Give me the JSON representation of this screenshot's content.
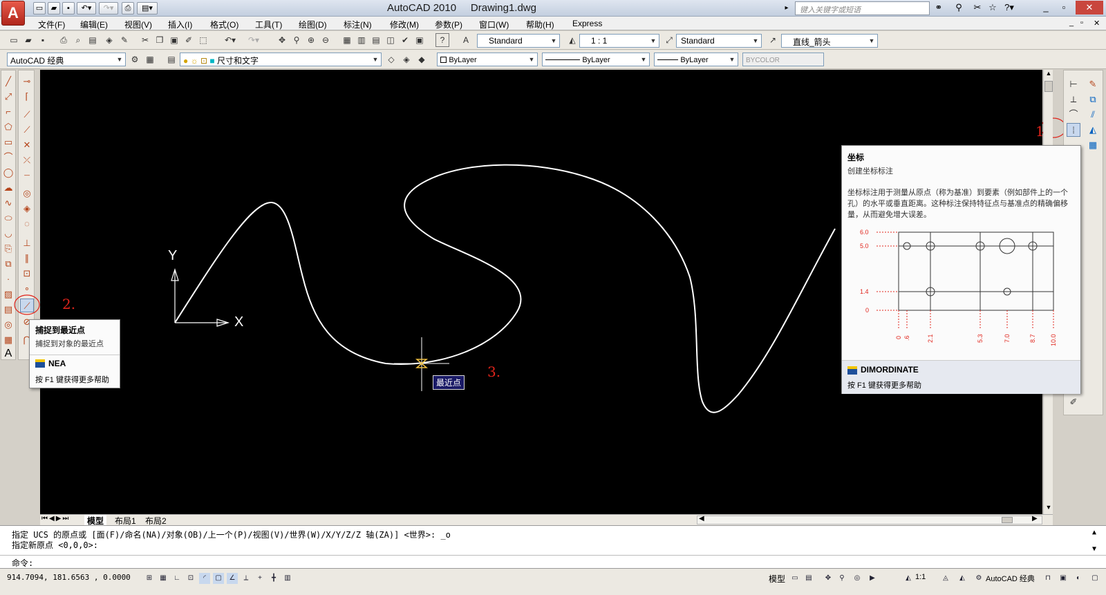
{
  "titlebar": {
    "app_button": "A",
    "app_name": "AutoCAD 2010",
    "doc_name": "Drawing1.dwg",
    "search_placeholder": "键入关键字或短语",
    "minimize": "_",
    "restore": "▫",
    "close": "✕"
  },
  "menubar": {
    "items": [
      "文件(F)",
      "编辑(E)",
      "视图(V)",
      "插入(I)",
      "格式(O)",
      "工具(T)",
      "绘图(D)",
      "标注(N)",
      "修改(M)",
      "参数(P)",
      "窗口(W)",
      "帮助(H)",
      "Express"
    ]
  },
  "toolbar1": {
    "text_style": "Standard",
    "scale": "1 : 1",
    "dim_style": "Standard",
    "multileader_style": "直线_箭头"
  },
  "toolbar2": {
    "workspace": "AutoCAD 经典",
    "layer": "尺寸和文字",
    "color": "ByLayer",
    "linetype": "ByLayer",
    "lineweight": "ByLayer",
    "plotstyle": "BYCOLOR"
  },
  "annotations": {
    "step1": "1.",
    "step2": "2.",
    "step3": "3."
  },
  "ucs": {
    "x_label": "X",
    "y_label": "Y"
  },
  "osnap_marker_label": "最近点",
  "tooltip_nea": {
    "title": "捕捉到最近点",
    "desc": "捕捉到对象的最近点",
    "command": "NEA",
    "help": "按 F1 键获得更多帮助"
  },
  "tooltip_dimordinate": {
    "title": "坐标",
    "subtitle": "创建坐标标注",
    "desc": "坐标标注用于测量从原点（称为基准）到要素（例如部件上的一个孔）的水平或垂直距离。这种标注保持特征点与基准点的精确偏移量，从而避免增大误差。",
    "y_ticks": [
      "6.0",
      "5.0",
      "1.4",
      "0"
    ],
    "x_ticks": [
      "0",
      ".6",
      "2.1",
      "5.3",
      "7.0",
      "8.7",
      "10.0"
    ],
    "command": "DIMORDINATE",
    "help": "按 F1 键获得更多帮助"
  },
  "layout_tabs": [
    "模型",
    "布局1",
    "布局2"
  ],
  "command_window": {
    "line1": "指定 UCS 的原点或 [面(F)/命名(NA)/对象(OB)/上一个(P)/视图(V)/世界(W)/X/Y/Z/Z 轴(ZA)] <世界>: _o",
    "line2": "指定新原点 <0,0,0>:",
    "prompt": "命令:"
  },
  "statusbar": {
    "coords": "914.7094,  181.6563 , 0.0000",
    "model": "模型",
    "anno_scale": "1:1",
    "workspace": "AutoCAD 经典"
  },
  "colors": {
    "canvas": "#000000",
    "annotation_red": "#e0241b",
    "curve": "#ffffff",
    "tooltip_red": "#e0241b"
  }
}
